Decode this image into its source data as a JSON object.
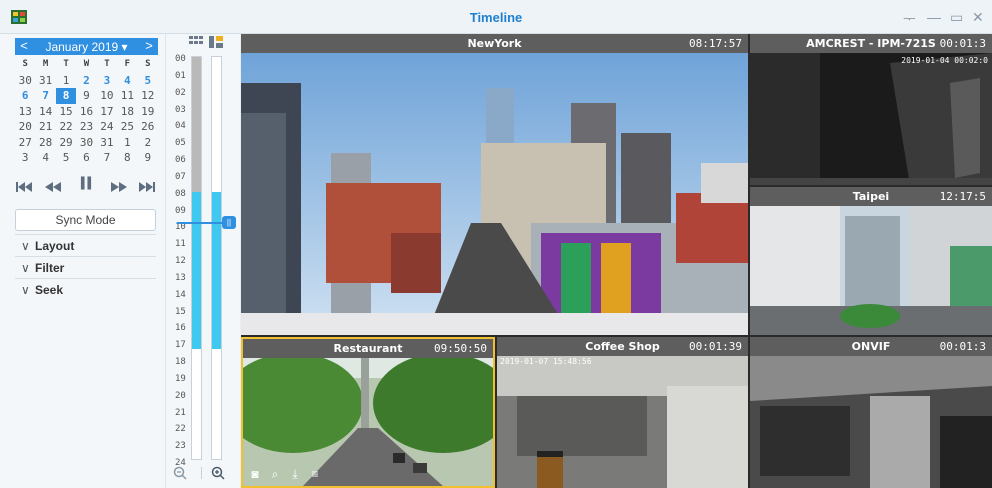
{
  "window": {
    "title": "Timeline",
    "controls": [
      "pin-icon",
      "minimize-icon",
      "maximize-icon",
      "close-icon"
    ]
  },
  "calendar": {
    "month_label": "January 2019 ▾",
    "prev_label": "<",
    "next_label": ">",
    "weekdays": [
      "S",
      "M",
      "T",
      "W",
      "T",
      "F",
      "S"
    ],
    "weeks": [
      [
        "30",
        "31",
        "1",
        "2",
        "3",
        "4",
        "5"
      ],
      [
        "6",
        "7",
        "8",
        "9",
        "10",
        "11",
        "12"
      ],
      [
        "13",
        "14",
        "15",
        "16",
        "17",
        "18",
        "19"
      ],
      [
        "20",
        "21",
        "22",
        "23",
        "24",
        "25",
        "26"
      ],
      [
        "27",
        "28",
        "29",
        "30",
        "31",
        "1",
        "2"
      ],
      [
        "3",
        "4",
        "5",
        "6",
        "7",
        "8",
        "9"
      ]
    ],
    "selected_day": "8",
    "days_with_recordings": [
      "2",
      "3",
      "4",
      "5",
      "6",
      "7"
    ]
  },
  "playback": {
    "buttons": [
      "skip-back-icon",
      "rewind-icon",
      "pause-icon",
      "fast-forward-icon",
      "skip-forward-icon"
    ]
  },
  "sync_mode_label": "Sync Mode",
  "sections": [
    "Layout",
    "Filter",
    "Seek"
  ],
  "timeline": {
    "hours": [
      "00",
      "01",
      "02",
      "03",
      "04",
      "05",
      "06",
      "07",
      "08",
      "09",
      "10",
      "11",
      "12",
      "13",
      "14",
      "15",
      "16",
      "17",
      "18",
      "19",
      "20",
      "21",
      "22",
      "23",
      "24"
    ],
    "current_hour_fraction": 0.418,
    "zoom_out": "zoom-out-icon",
    "zoom_in": "zoom-in-icon"
  },
  "cameras": [
    {
      "name": "NewYork",
      "time": "08:17:57"
    },
    {
      "name": "AMCREST - IPM-721S",
      "time": "00:01:3",
      "osd": "2019-01-04 00:02:0"
    },
    {
      "name": "Taipei",
      "time": "12:17:5"
    },
    {
      "name": "Restaurant",
      "time": "09:50:50"
    },
    {
      "name": "Coffee Shop",
      "time": "00:01:39",
      "osd": "2019-01-07 15:48:56"
    },
    {
      "name": "ONVIF",
      "time": "00:01:3"
    }
  ],
  "colors": {
    "accent": "#2f8fe0",
    "selected_border": "#f0c030",
    "recording_bar": "#3fc8f0",
    "header_gray": "#5e5e5e"
  }
}
